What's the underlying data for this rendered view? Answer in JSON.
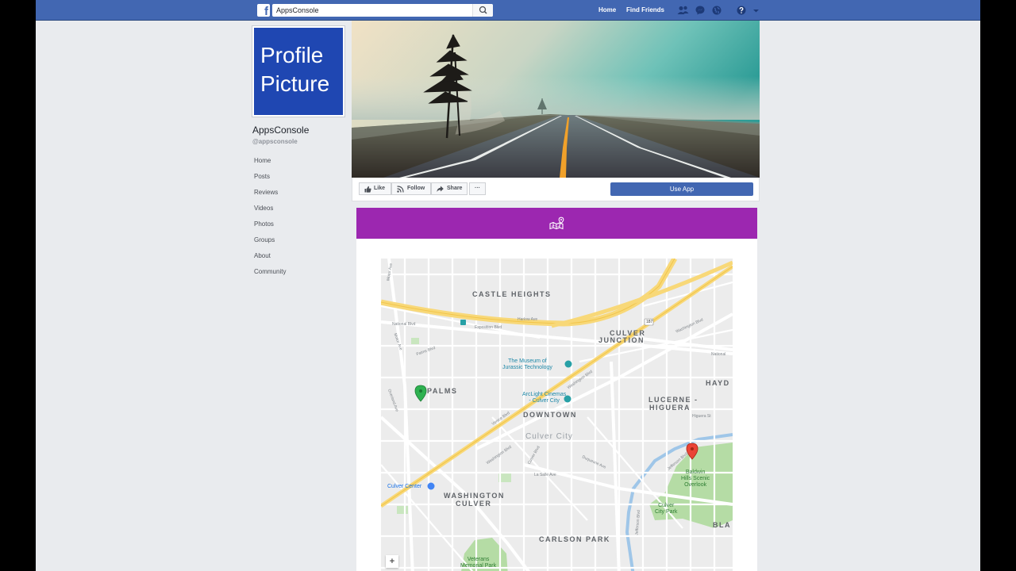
{
  "topbar": {
    "search_value": "AppsConsole",
    "nav": {
      "home": "Home",
      "find_friends": "Find Friends"
    },
    "brand_color": "#4267b2"
  },
  "profile": {
    "picture_line1": "Profile",
    "picture_line2": "Picture",
    "name": "AppsConsole",
    "handle": "@appsconsole"
  },
  "sidebar": {
    "items": [
      {
        "label": "Home"
      },
      {
        "label": "Posts"
      },
      {
        "label": "Reviews"
      },
      {
        "label": "Videos"
      },
      {
        "label": "Photos"
      },
      {
        "label": "Groups"
      },
      {
        "label": "About"
      },
      {
        "label": "Community"
      }
    ]
  },
  "actions": {
    "like": "Like",
    "follow": "Follow",
    "share": "Share",
    "more": "···",
    "use_app": "Use App"
  },
  "app": {
    "header_color": "#9c27b0",
    "header_icon": "map-route-icon"
  },
  "map": {
    "districts": {
      "castle_heights": "CASTLE HEIGHTS",
      "culver_junction_1": "CULVER",
      "culver_junction_2": "JUNCTION",
      "palms": "PALMS",
      "downtown": "DOWNTOWN",
      "lucerne_1": "LUCERNE -",
      "lucerne_2": "HIGUERA",
      "washington_culver_1": "WASHINGTON",
      "washington_culver_2": "CULVER",
      "carlson_park": "CARLSON PARK",
      "hayden": "HAYD",
      "blair": "BLA"
    },
    "city": "Culver City",
    "pois": {
      "museum_1": "The Museum of",
      "museum_2": "Jurassic Technology",
      "arclight_1": "ArcLight Cinemas",
      "arclight_2": "- Culver City",
      "culver_center": "Culver Center",
      "baldwin_1": "Baldwin",
      "baldwin_2": "Hills Scenic",
      "baldwin_3": "Overlook",
      "culver_city_park_1": "Culver",
      "culver_city_park_2": "City Park",
      "veterans_1": "Veterans",
      "veterans_2": "Memorial Park"
    },
    "streets": {
      "venice": "Venice Blvd",
      "washington_1": "Washington Blvd",
      "washington_2": "Washington Blvd",
      "washington_3": "Washington Blvd",
      "culver": "Culver Blvd",
      "jefferson_1": "Jefferson Blvd",
      "jefferson_2": "Jefferson Blvd",
      "national": "National Blvd",
      "national_2": "National",
      "duquesne": "Duquesne Ave",
      "palms_blvd": "Palms Blvd",
      "motor": "Motor Ave",
      "motor_2": "Motor Ave",
      "overland": "Overland Ave",
      "exposition": "Exposition Blvd",
      "harlow": "Harlow Ave",
      "higuera": "Higuera St",
      "la_salle": "La Salle Ave",
      "route": "187"
    },
    "zoom_in": "+"
  }
}
